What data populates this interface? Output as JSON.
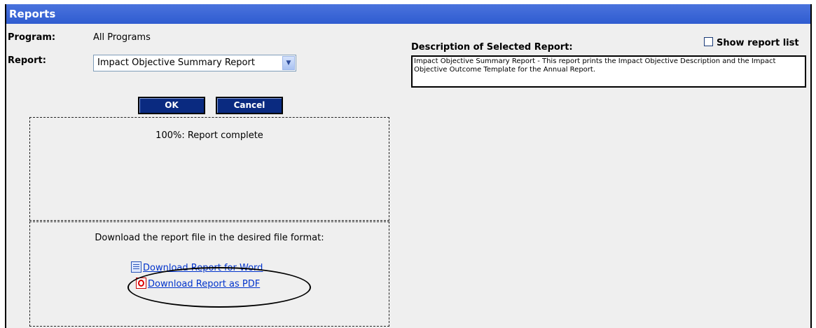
{
  "panel": {
    "title": "Reports"
  },
  "form": {
    "program_label": "Program:",
    "program_value": "All Programs",
    "report_label": "Report:",
    "report_selected": "Impact Objective Summary Report"
  },
  "buttons": {
    "ok_label": "OK",
    "cancel_label": "Cancel"
  },
  "progress": {
    "status_text": "100%: Report complete",
    "percent": 100
  },
  "download": {
    "instruction": "Download the report file in the desired file format:",
    "word_link": "Download Report for Word",
    "pdf_link": "Download Report as PDF",
    "word_icon": "word-document-icon",
    "pdf_icon": "pdf-document-icon"
  },
  "description": {
    "heading": "Description of Selected Report:",
    "text": "Impact Objective Summary Report - This report prints the Impact Objective Description and the Impact Objective Outcome Template for the Annual Report."
  },
  "show_report_list": {
    "label": "Show report list",
    "checked": false
  },
  "colors": {
    "title_bar": "#2f5cd0",
    "button_bg": "#0a2a80",
    "link": "#0033cc",
    "panel_bg": "#efefef"
  }
}
